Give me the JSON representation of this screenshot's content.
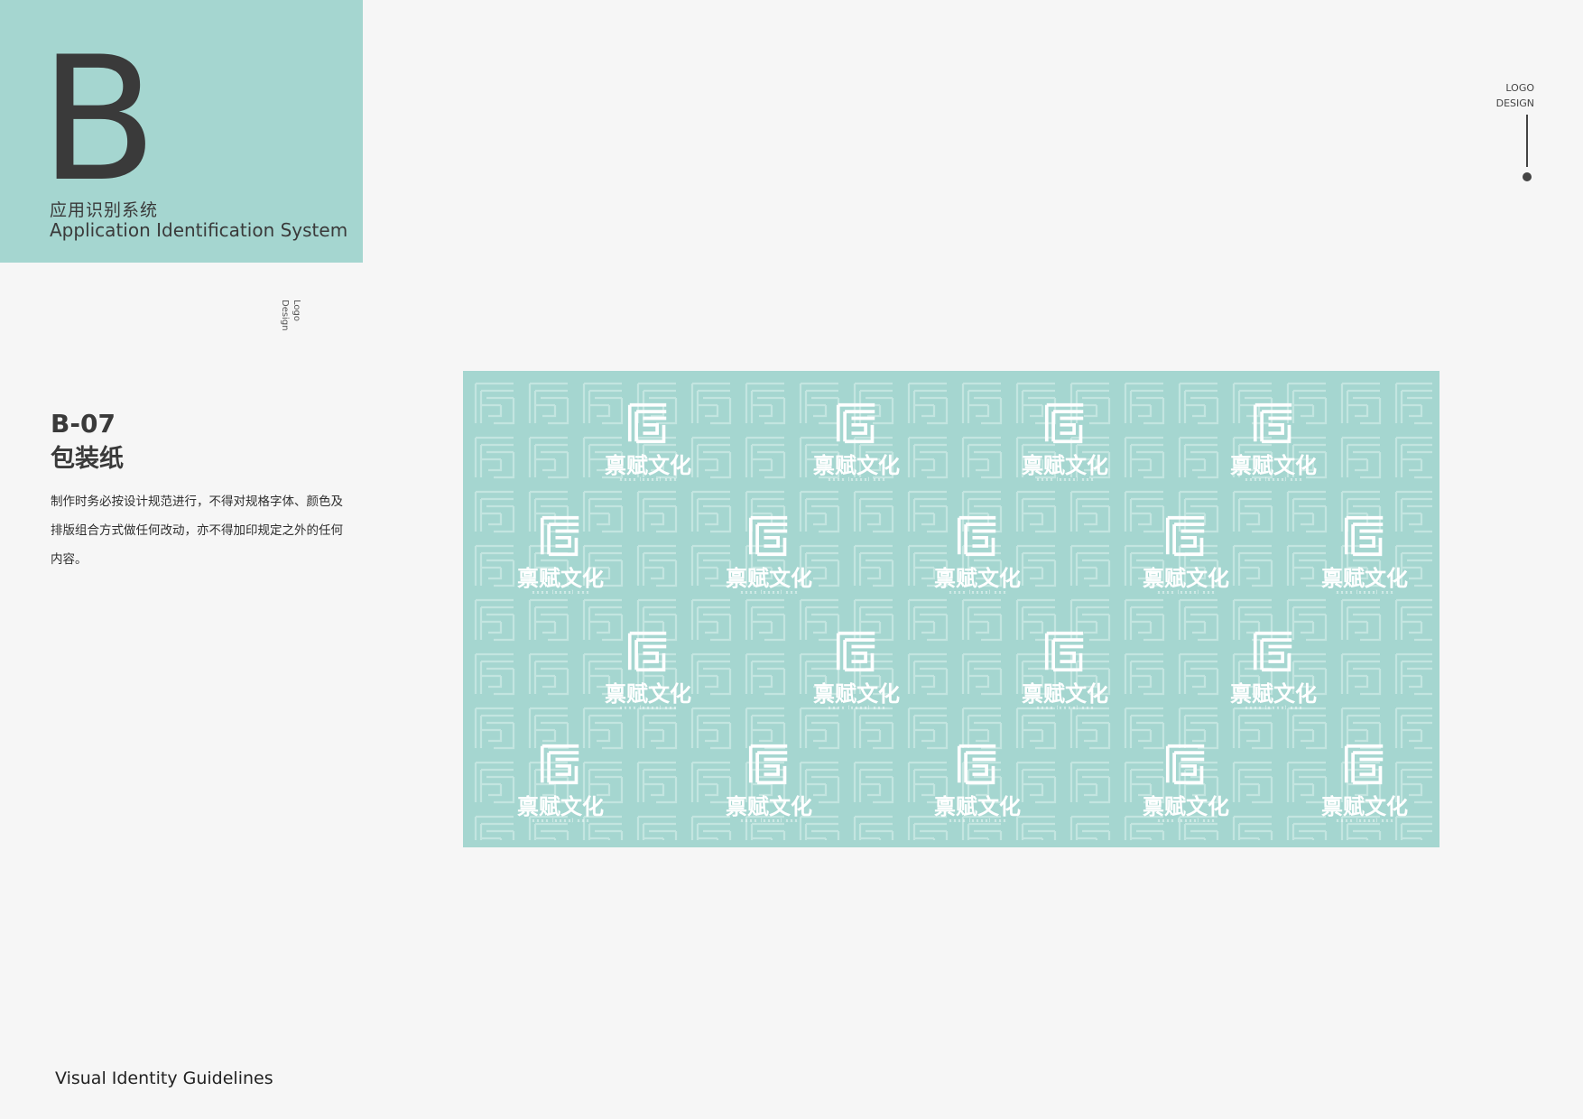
{
  "section": {
    "letter": "B",
    "title_cn": "应用识别系统",
    "title_en": "Application Identification System"
  },
  "side_label": {
    "line1": "Logo",
    "line2": "Design"
  },
  "top_right": {
    "line1": "LOGO",
    "line2": "DESIGN"
  },
  "item": {
    "code": "B-07",
    "name": "包装纸",
    "description": "制作时务必按设计规范进行，不得对规格字体、颜色及排版组合方式做任何改动，亦不得加印规定之外的任何内容。"
  },
  "wrapping_paper": {
    "brand_name": "禀赋文化",
    "brand_sub": "ｘｘｘｘ（ｘｘｘｘ）ｘｘｘ",
    "background_color": "#a5d6d0",
    "logo_color": "#ffffff",
    "logo_icon": "fs-monogram-icon"
  },
  "footer": {
    "text": "Visual Identity Guidelines"
  }
}
